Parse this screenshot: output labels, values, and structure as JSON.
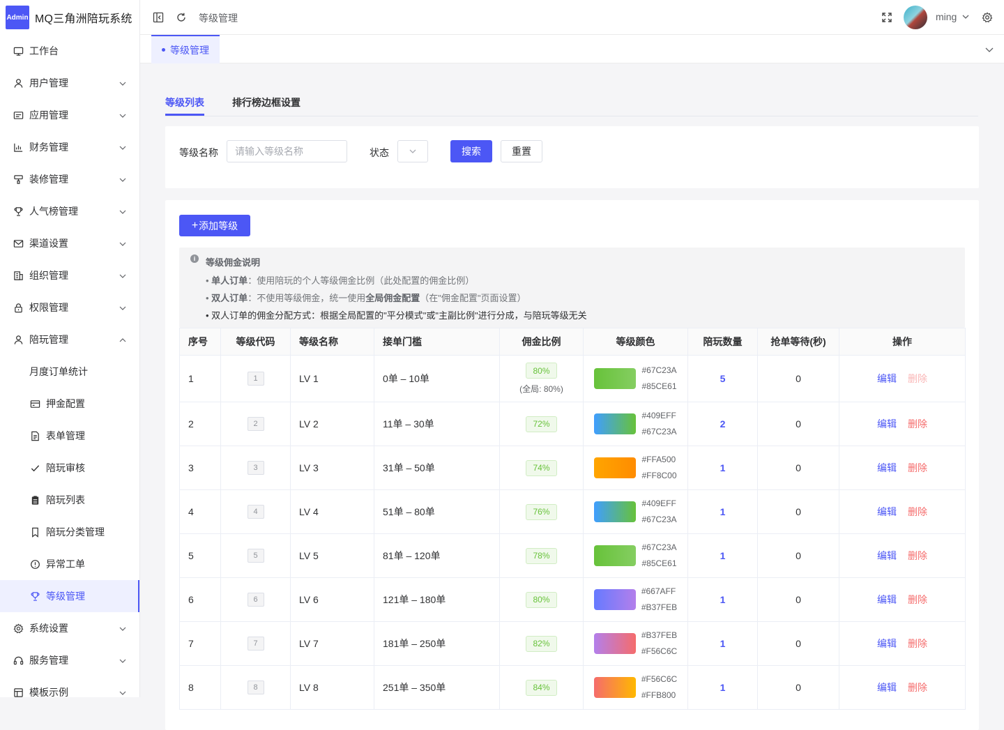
{
  "brand": {
    "logo": "Admin",
    "title": "MQ三角洲陪玩系统"
  },
  "sidebar": {
    "top_items": [
      {
        "label": "工作台",
        "icon": "monitor-icon"
      },
      {
        "label": "用户管理",
        "icon": "user-icon"
      },
      {
        "label": "应用管理",
        "icon": "app-icon"
      },
      {
        "label": "财务管理",
        "icon": "chart-icon"
      },
      {
        "label": "装修管理",
        "icon": "brush-icon"
      },
      {
        "label": "人气榜管理",
        "icon": "trophy-icon"
      },
      {
        "label": "渠道设置",
        "icon": "mail-icon"
      },
      {
        "label": "组织管理",
        "icon": "building-icon"
      },
      {
        "label": "权限管理",
        "icon": "lock-icon"
      },
      {
        "label": "陪玩管理",
        "icon": "user-icon"
      }
    ],
    "sub_items": [
      {
        "label": "月度订单统计"
      },
      {
        "label": "押金配置"
      },
      {
        "label": "表单管理"
      },
      {
        "label": "陪玩审核"
      },
      {
        "label": "陪玩列表"
      },
      {
        "label": "陪玩分类管理"
      },
      {
        "label": "异常工单"
      },
      {
        "label": "等级管理"
      }
    ],
    "bottom_items": [
      {
        "label": "系统设置"
      },
      {
        "label": "服务管理"
      },
      {
        "label": "模板示例"
      }
    ]
  },
  "header": {
    "breadcrumb": "等级管理",
    "username": "ming"
  },
  "tagsbar": {
    "active_tag": "等级管理"
  },
  "tabs": {
    "list": "等级列表",
    "border": "排行榜边框设置"
  },
  "search": {
    "name_label": "等级名称",
    "name_placeholder": "请输入等级名称",
    "status_label": "状态",
    "search_btn": "搜索",
    "reset_btn": "重置"
  },
  "add_btn": "添加等级",
  "notice": {
    "title": "等级佣金说明",
    "l1_bold": "单人订单",
    "l1_text": "：使用陪玩的个人等级佣金比例（此处配置的佣金比例）",
    "l2_bold": "双人订单",
    "l2_text_a": "：不使用等级佣金，统一使用",
    "l2_bold2": "全局佣金配置",
    "l2_text_b": "（在\"佣金配置\"页面设置）",
    "l3": "双人订单的佣金分配方式：根据全局配置的\"平分模式\"或\"主副比例\"进行分成，与陪玩等级无关"
  },
  "table": {
    "headers": [
      "序号",
      "等级代码",
      "等级名称",
      "接单门槛",
      "佣金比例",
      "等级颜色",
      "陪玩数量",
      "抢单等待(秒)",
      "操作"
    ],
    "edit_label": "编辑",
    "delete_label": "删除",
    "global_note": "(全局: 80%)",
    "rows": [
      {
        "idx": "1",
        "code": "1",
        "name": "LV 1",
        "range": "0单 – 10单",
        "pct": "80%",
        "c1": "#67C23A",
        "c2": "#85CE61",
        "count": "5",
        "wait": "0"
      },
      {
        "idx": "2",
        "code": "2",
        "name": "LV 2",
        "range": "11单 – 30单",
        "pct": "72%",
        "c1": "#409EFF",
        "c2": "#67C23A",
        "count": "2",
        "wait": "0"
      },
      {
        "idx": "3",
        "code": "3",
        "name": "LV 3",
        "range": "31单 – 50单",
        "pct": "74%",
        "c1": "#FFA500",
        "c2": "#FF8C00",
        "count": "1",
        "wait": "0"
      },
      {
        "idx": "4",
        "code": "4",
        "name": "LV 4",
        "range": "51单 – 80单",
        "pct": "76%",
        "c1": "#409EFF",
        "c2": "#67C23A",
        "count": "1",
        "wait": "0"
      },
      {
        "idx": "5",
        "code": "5",
        "name": "LV 5",
        "range": "81单 – 120单",
        "pct": "78%",
        "c1": "#67C23A",
        "c2": "#85CE61",
        "count": "1",
        "wait": "0"
      },
      {
        "idx": "6",
        "code": "6",
        "name": "LV 6",
        "range": "121单 – 180单",
        "pct": "80%",
        "c1": "#667AFF",
        "c2": "#B37FEB",
        "count": "1",
        "wait": "0"
      },
      {
        "idx": "7",
        "code": "7",
        "name": "LV 7",
        "range": "181单 – 250单",
        "pct": "82%",
        "c1": "#B37FEB",
        "c2": "#F56C6C",
        "count": "1",
        "wait": "0"
      },
      {
        "idx": "8",
        "code": "8",
        "name": "LV 8",
        "range": "251单 – 350单",
        "pct": "84%",
        "c1": "#F56C6C",
        "c2": "#FFB800",
        "count": "1",
        "wait": "0"
      }
    ]
  },
  "colors": {
    "accent": "#4c57f5",
    "success": "#67c23a",
    "danger": "#f56c6c"
  }
}
